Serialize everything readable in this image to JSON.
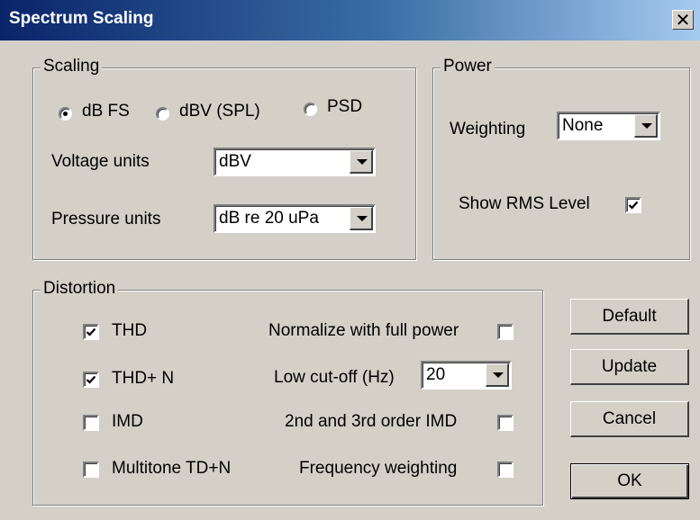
{
  "window": {
    "title": "Spectrum Scaling",
    "close_glyph": "✕"
  },
  "scaling": {
    "legend": "Scaling",
    "radios": [
      {
        "label": "dB FS",
        "selected": true
      },
      {
        "label": "dBV (SPL)",
        "selected": false
      },
      {
        "label": "PSD",
        "selected": false
      }
    ],
    "voltage_units": {
      "label": "Voltage units",
      "value": "dBV"
    },
    "pressure_units": {
      "label": "Pressure units",
      "value": "dB re 20 uPa"
    }
  },
  "power": {
    "legend": "Power",
    "weighting": {
      "label": "Weighting",
      "value": "None"
    },
    "show_rms": {
      "label": "Show RMS Level",
      "checked": true
    }
  },
  "distortion": {
    "legend": "Distortion",
    "left": [
      {
        "label": "THD",
        "checked": true
      },
      {
        "label": "THD+ N",
        "checked": true
      },
      {
        "label": "IMD",
        "checked": false
      },
      {
        "label": "Multitone TD+N",
        "checked": false
      }
    ],
    "normalize": {
      "label": "Normalize with full power",
      "checked": false
    },
    "low_cutoff": {
      "label": "Low cut-off (Hz)",
      "value": "20"
    },
    "order_imd": {
      "label": "2nd and 3rd order IMD",
      "checked": false
    },
    "freq_weighting": {
      "label": "Frequency weighting",
      "checked": false
    }
  },
  "buttons": {
    "default": "Default",
    "update": "Update",
    "cancel": "Cancel",
    "ok": "OK"
  }
}
